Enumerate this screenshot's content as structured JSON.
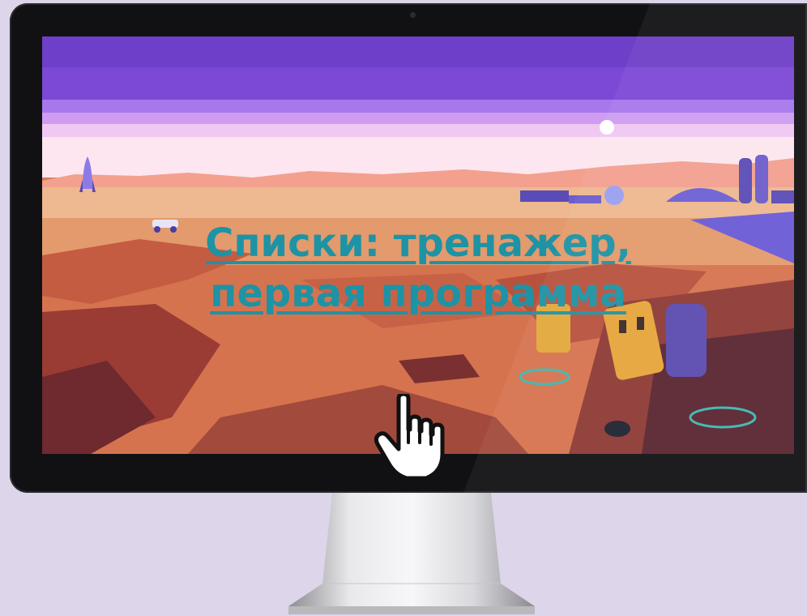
{
  "screen": {
    "title_line1": "Списки: тренажер,",
    "title_line2": "первая программа"
  },
  "colors": {
    "link": "#1d93a5",
    "background": "#ddd5ea",
    "bezel": "#111114"
  },
  "cursor": "hand-pointer-icon"
}
